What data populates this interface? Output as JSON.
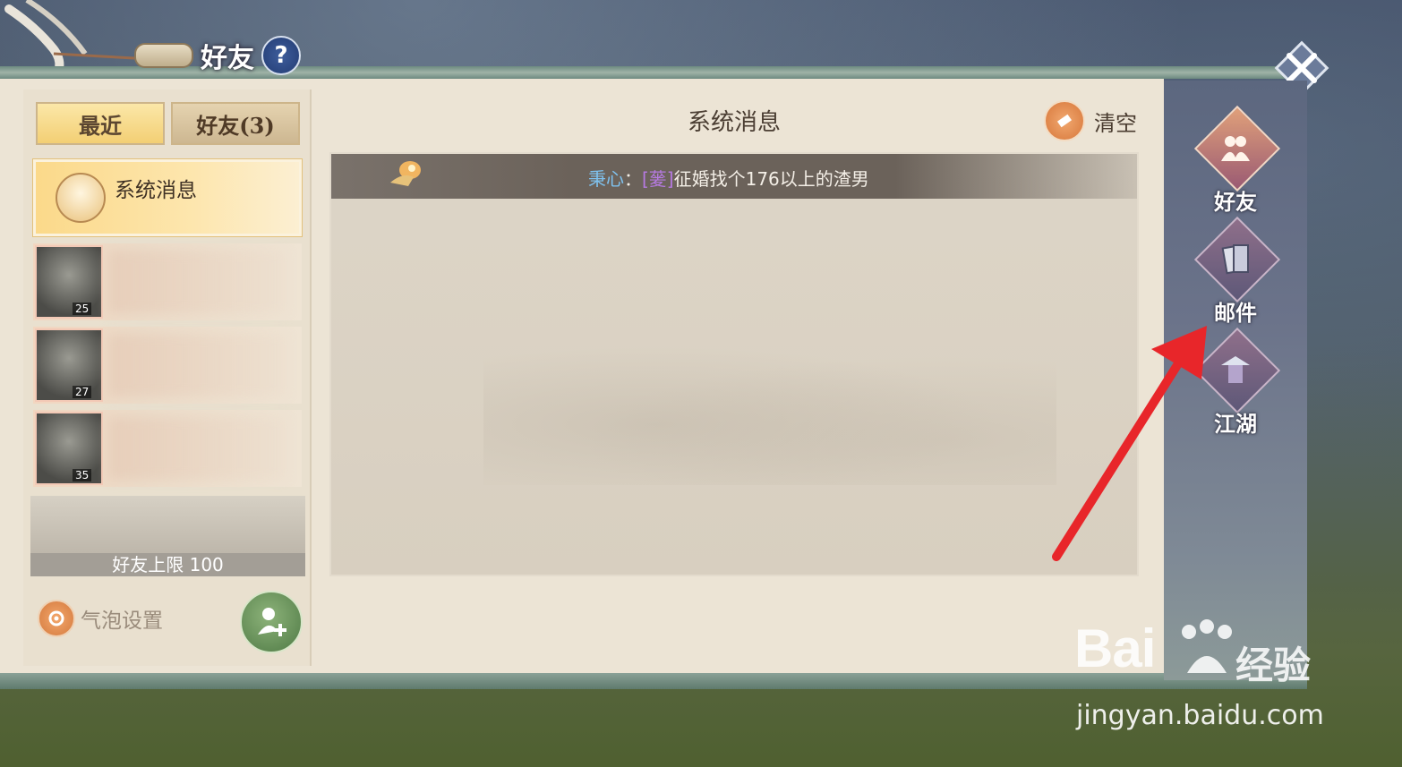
{
  "window": {
    "title": "好友",
    "help_label": "?"
  },
  "left_tabs": [
    {
      "label": "最近",
      "active": true
    },
    {
      "label": "好友(3)",
      "active": false
    }
  ],
  "conversation_list": {
    "system_item": {
      "label": "系统消息"
    },
    "friends": [
      {
        "level": "25"
      },
      {
        "level": "27"
      },
      {
        "level": "35"
      }
    ],
    "friend_limit": "好友上限 100"
  },
  "bubble_settings": {
    "label": "气泡设置",
    "icon": "gear-icon"
  },
  "add_friend": {
    "icon": "add-friend-icon"
  },
  "main": {
    "title": "系统消息",
    "clear_label": "清空",
    "message": {
      "sender": "秉心",
      "separator": "：",
      "tag": "[蓌]",
      "text": "征婚找个176以上的渣男"
    }
  },
  "side_nav": [
    {
      "label": "好友",
      "icon": "friends-icon",
      "active": true
    },
    {
      "label": "邮件",
      "icon": "mail-icon",
      "active": false
    },
    {
      "label": "江湖",
      "icon": "jianghu-icon",
      "active": false
    }
  ],
  "watermark": {
    "brand": "Bai",
    "brand_suffix": "经验",
    "url": "jingyan.baidu.com"
  },
  "colors": {
    "accent_gold": "#f3cf74",
    "sender_blue": "#7fc2ef",
    "tag_purple": "#b57ae0",
    "arrow_red": "#e8262a"
  }
}
